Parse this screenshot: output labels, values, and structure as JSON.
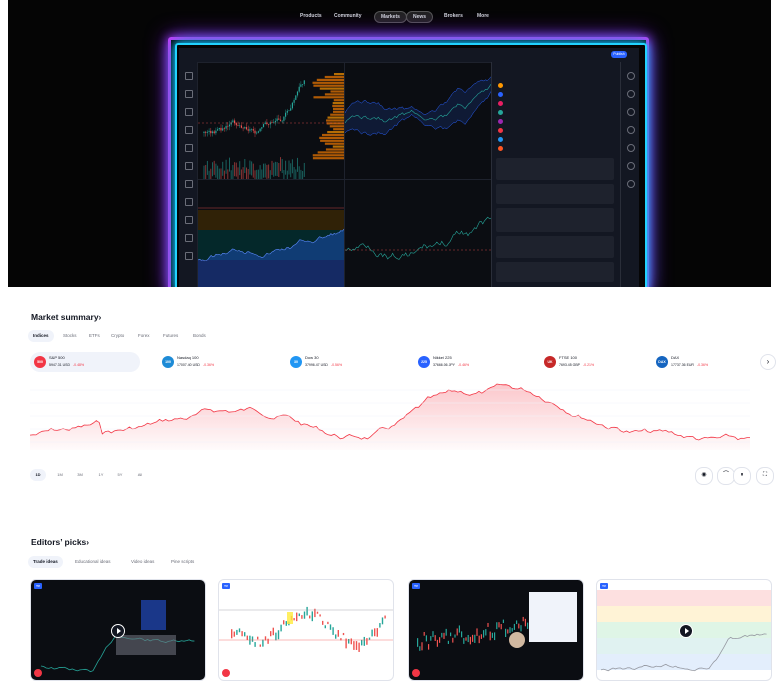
{
  "nav": {
    "items": [
      "Products",
      "Community",
      "Markets",
      "News",
      "Brokers",
      "More"
    ],
    "active": "Markets"
  },
  "hero": {
    "neon_colors": {
      "outer": "#c93cff",
      "inner": "#22d3ff"
    },
    "publish_label": "Publish"
  },
  "market_summary": {
    "title": "Market summary›",
    "tabs": [
      "Indices",
      "Stocks",
      "ETFs",
      "Crypto",
      "Forex",
      "Futures",
      "Bonds"
    ],
    "active_tab": "Indices",
    "indices": [
      {
        "logo": "500",
        "name": "S&P 500",
        "value": "5947.31 USD",
        "change": "-0.48%",
        "color": "#f23645"
      },
      {
        "logo": "100",
        "name": "Nasdaq 100",
        "value": "17007.40 USD",
        "change": "-0.36%",
        "color": "#1e8bd6"
      },
      {
        "logo": "30",
        "name": "Dow 30",
        "value": "37996.47 USD",
        "change": "-0.56%",
        "color": "#2196f3"
      },
      {
        "logo": "225",
        "name": "Nikkei 225",
        "value": "37666.06 JPY",
        "change": "-0.46%",
        "color": "#2962ff"
      },
      {
        "logo": "UK",
        "name": "FTSE 100",
        "value": "7693.45 GBP",
        "change": "-0.21%",
        "color": "#c62828"
      },
      {
        "logo": "DAX",
        "name": "DAX",
        "value": "17737.36 EUR",
        "change": "-0.36%",
        "color": "#1565c0"
      }
    ],
    "accent_color": "#f23645",
    "ranges": [
      "1D",
      "1M",
      "3M",
      "1Y",
      "5Y",
      "All"
    ],
    "active_range": "1D"
  },
  "editors_picks": {
    "title": "Editors’ picks›",
    "tabs": [
      "Trade ideas",
      "Educational ideas",
      "Video ideas",
      "Pine scripts"
    ],
    "active_tab": "Trade ideas"
  }
}
